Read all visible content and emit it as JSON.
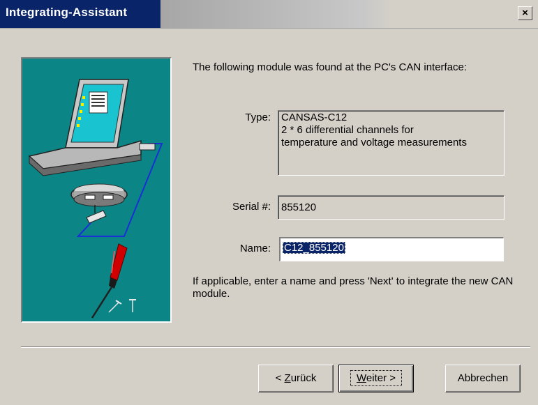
{
  "window": {
    "title": "Integrating-Assistant",
    "close_glyph": "×"
  },
  "content": {
    "intro": "The following module was found at the PC's CAN interface:",
    "type_label": "Type:",
    "type_lines": [
      "CANSAS-C12",
      "2 * 6 differential channels for",
      "temperature and voltage measurements"
    ],
    "serial_label": "Serial #:",
    "serial_value": "855120",
    "name_label": "Name:",
    "name_value": "C12_855120",
    "hint": "If applicable, enter a name and press 'Next' to integrate the new CAN module."
  },
  "buttons": {
    "back_prefix": "< ",
    "back_mnemonic": "Z",
    "back_rest": "urück",
    "next_mnemonic": "W",
    "next_rest": "eiter >",
    "cancel": "Abbrechen"
  },
  "illustration": {
    "icons": [
      "laptop-icon",
      "can-module-icon",
      "screwdriver-icon",
      "nail-icon",
      "pin-icon"
    ]
  },
  "colors": {
    "titlebar": "#0a246a",
    "panel_teal": "#0b8585",
    "window_bg": "#d4d0c8",
    "selection": "#0a246a"
  }
}
